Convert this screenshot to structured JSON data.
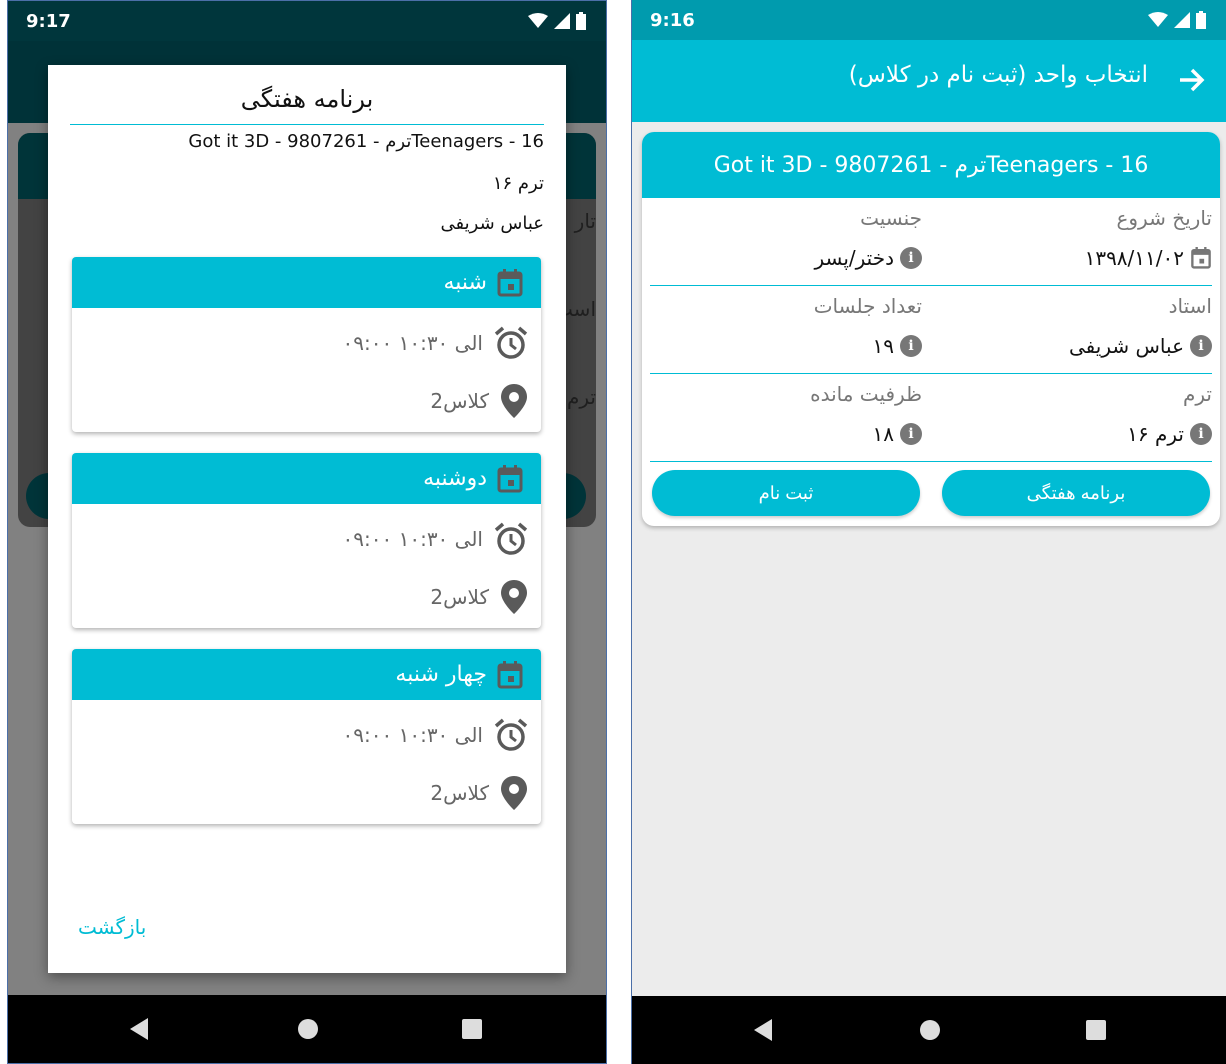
{
  "left_phone": {
    "time": "9:17",
    "dialog": {
      "title": "برنامه هفتگی",
      "course_name": "Teenagers - 16ترم - Got it 3D - 9807261",
      "term": "ترم ۱۶",
      "teacher": "عباس شریفی",
      "days": [
        {
          "day": "شنبه",
          "time": "۰۹:۰۰ الی ۱۰:۳۰",
          "location": "کلاس2"
        },
        {
          "day": "دوشنبه",
          "time": "۰۹:۰۰ الی ۱۰:۳۰",
          "location": "کلاس2"
        },
        {
          "day": "چهار شنبه",
          "time": "۰۹:۰۰ الی ۱۰:۳۰",
          "location": "کلاس2"
        }
      ],
      "back_button": "بازگشت"
    },
    "background_fragments": {
      "label_1": "تار",
      "label_2": "است",
      "label_3": "ترم"
    }
  },
  "right_phone": {
    "time": "9:16",
    "appbar_title": "انتخاب واحد (ثبت نام در کلاس)",
    "card": {
      "title": "Teenagers - 16ترم - Got it 3D - 9807261",
      "rows": [
        {
          "right_label": "تاریخ شروع",
          "right_value": "۱۳۹۸/۱۱/۰۲",
          "left_label": "جنسیت",
          "left_value": "دختر/پسر"
        },
        {
          "right_label": "استاد",
          "right_value": "عباس شریفی",
          "left_label": "تعداد جلسات",
          "left_value": "۱۹"
        },
        {
          "right_label": "ترم",
          "right_value": "ترم ۱۶",
          "left_label": "ظرفیت مانده",
          "left_value": "۱۸"
        }
      ],
      "schedule_button": "برنامه هفتگی",
      "register_button": "ثبت نام"
    }
  },
  "icons": {
    "wifi": "wifi-icon",
    "signal": "signal-icon",
    "battery": "battery-icon",
    "calendar": "calendar-icon",
    "clock": "alarm-clock-icon",
    "location": "location-pin-icon",
    "info": "info-icon",
    "back": "back-arrow-icon",
    "nav_back": "nav-back-icon",
    "nav_home": "nav-home-icon",
    "nav_recents": "nav-recents-icon"
  },
  "colors": {
    "accent": "#00bcd4",
    "status_dark": "#009bae",
    "scrim_status": "#00363c",
    "text_muted": "#777777",
    "navbar": "#000000"
  }
}
